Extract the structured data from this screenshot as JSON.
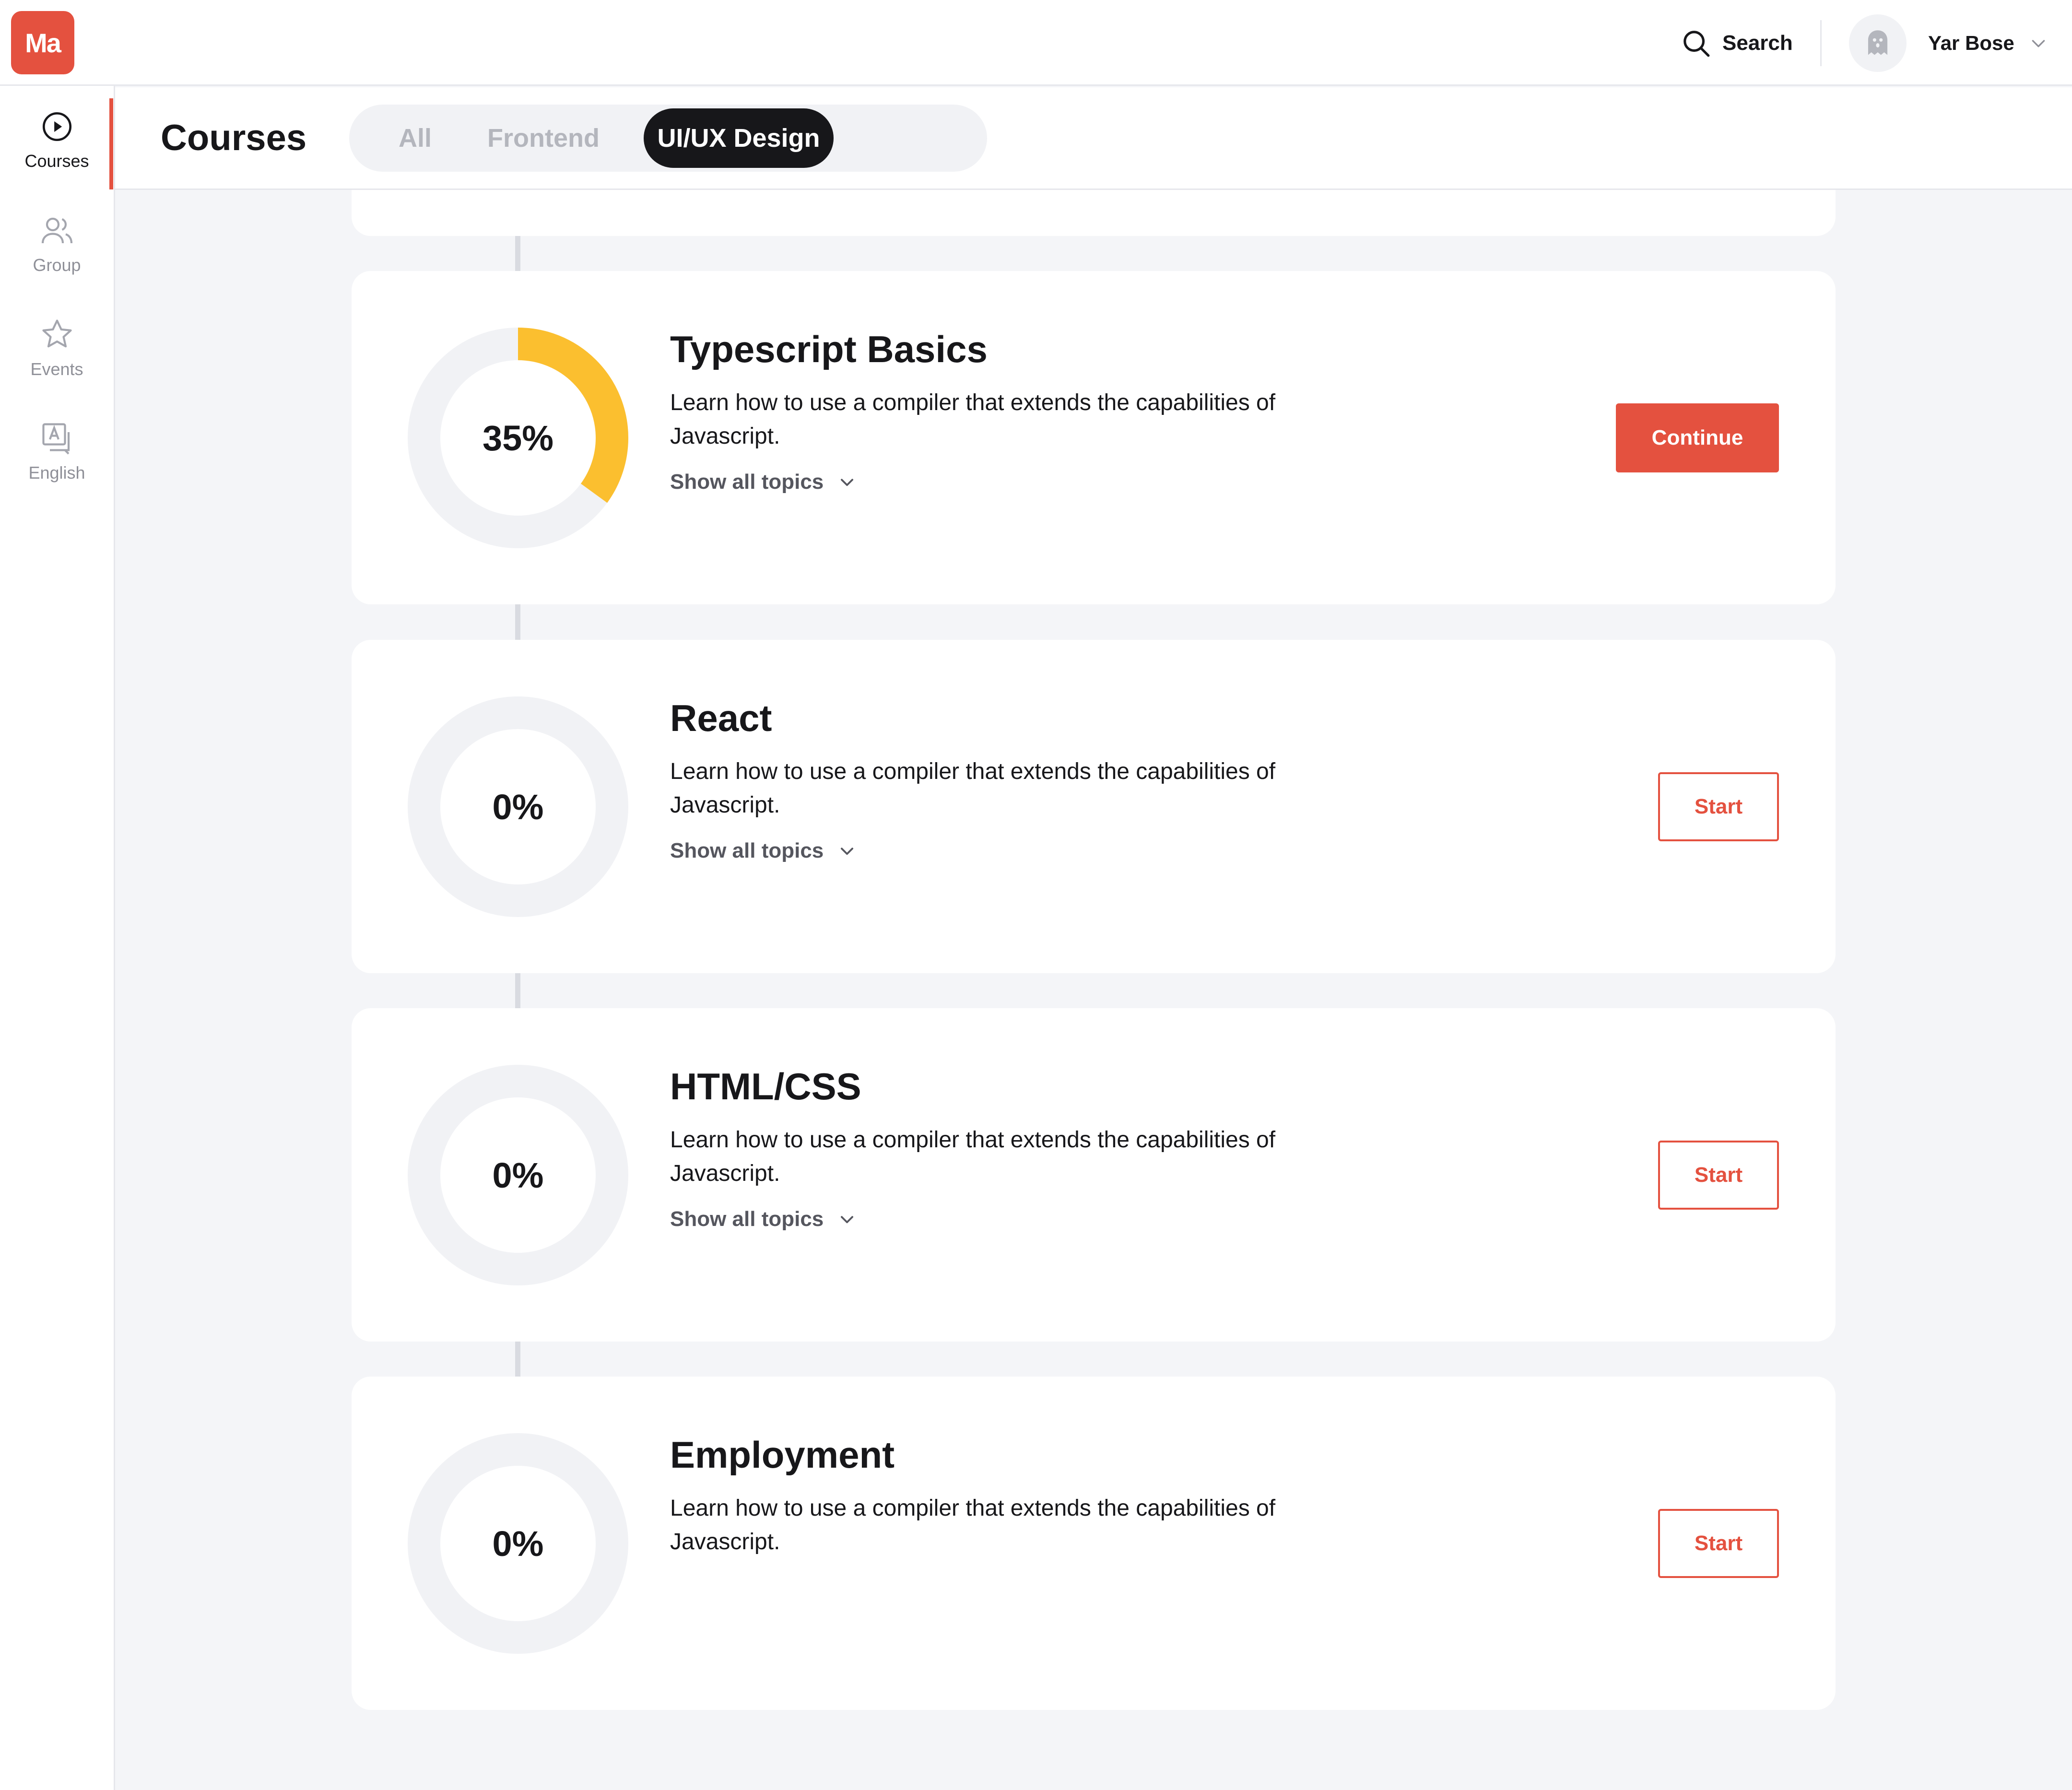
{
  "app": {
    "logo_text": "Ma",
    "brand_color": "#e4513f"
  },
  "topbar": {
    "search_label": "Search",
    "search_icon": "search-icon",
    "user_name": "Yar Bose",
    "avatar_icon": "ghost-avatar-icon",
    "user_menu_icon": "chevron-down-icon"
  },
  "sidebar": {
    "items": [
      {
        "label": "Courses",
        "icon": "play-circle-icon",
        "active": true
      },
      {
        "label": "Group",
        "icon": "users-icon",
        "active": false
      },
      {
        "label": "Events",
        "icon": "star-icon",
        "active": false
      },
      {
        "label": "English",
        "icon": "translate-icon",
        "active": false
      }
    ]
  },
  "header": {
    "title": "Courses",
    "tabs": [
      {
        "label": "All",
        "active": false
      },
      {
        "label": "Frontend",
        "active": false
      },
      {
        "label": "UI/UX Design",
        "active": true
      }
    ]
  },
  "courses": [
    {
      "title": "Typescript Basics",
      "description": "Learn how to use a compiler that extends the capabilities of Javascript.",
      "progress_label": "35%",
      "progress": 0.35,
      "progress_color": "#fbbf2f",
      "topics_label": "Show all topics",
      "button_label": "Continue",
      "button_style": "primary"
    },
    {
      "title": "React",
      "description": "Learn how to use a compiler that extends the capabilities of Javascript.",
      "progress_label": "0%",
      "progress": 0,
      "topics_label": "Show all topics",
      "button_label": "Start",
      "button_style": "outline"
    },
    {
      "title": "HTML/CSS",
      "description": "Learn how to use a compiler that extends the capabilities of Javascript.",
      "progress_label": "0%",
      "progress": 0,
      "topics_label": "Show all topics",
      "button_label": "Start",
      "button_style": "outline"
    },
    {
      "title": "Employment",
      "description": "Learn how to use a compiler that extends the capabilities of Javascript.",
      "progress_label": "0%",
      "progress": 0,
      "button_label": "Start",
      "button_style": "outline"
    }
  ]
}
